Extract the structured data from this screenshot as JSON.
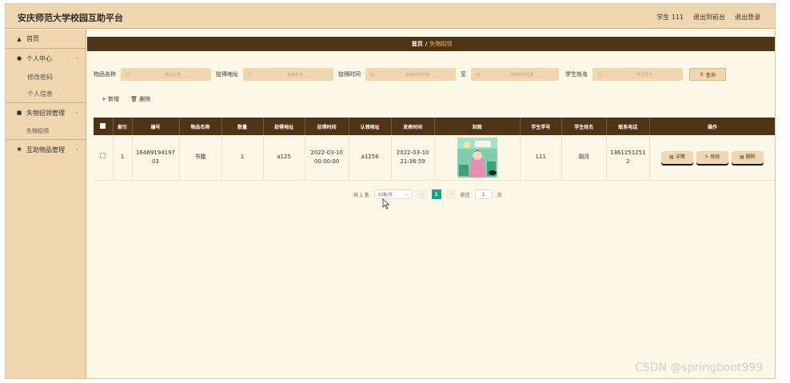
{
  "app": {
    "title": "安庆师范大学校园互助平台",
    "top_links": [
      "学生 111",
      "退出到前台",
      "退出登录"
    ]
  },
  "sidebar": {
    "items": [
      {
        "label": "首页",
        "icon": "home-icon"
      },
      {
        "label": "个人中心",
        "icon": "user-icon"
      },
      {
        "label": "修改密码"
      },
      {
        "label": "个人信息"
      },
      {
        "label": "失物招领管理",
        "icon": "folder-icon"
      },
      {
        "label": "失物招领"
      },
      {
        "label": "互助物品管理",
        "icon": "gear-icon"
      }
    ]
  },
  "breadcrumb": {
    "home": "首页",
    "sep": "/",
    "current": "失物招领"
  },
  "search": {
    "fields": [
      {
        "label": "物品名称",
        "placeholder": "物品名称"
      },
      {
        "label": "拾得地址",
        "placeholder": "拾得地址"
      },
      {
        "label": "拾得时间",
        "placeholder": "拾得时间开始"
      },
      {
        "label": "至",
        "placeholder": "拾得时间结束"
      },
      {
        "label": "学生姓名",
        "placeholder": "学生姓名"
      }
    ],
    "query_label": "查询"
  },
  "toolbar": {
    "add_label": "新增",
    "delete_label": "删除"
  },
  "table": {
    "headers": [
      "索引",
      "编号",
      "物品名称",
      "数量",
      "拾得地址",
      "拾得时间",
      "认领地址",
      "发表时间",
      "封面",
      "学生学号",
      "学生姓名",
      "联系电话",
      "操作"
    ],
    "rows": [
      {
        "index": "1",
        "code_l1": "16469194197",
        "code_l2": "03",
        "name": "书籍",
        "qty": "1",
        "pickup_addr": "a125",
        "pickup_date": "2022-03-10",
        "pickup_time": "00:00:00",
        "claim_addr": "a1256",
        "pub_date": "2022-03-10",
        "pub_time": "21:36:59",
        "student_no": "111",
        "student_name": "胡月",
        "phone_l1": "1361251251",
        "phone_l2": "2",
        "actions": [
          "详情",
          "修改",
          "删除"
        ]
      }
    ]
  },
  "pager": {
    "total": "共 1 条",
    "page_size": "10条/页",
    "current": "1",
    "goto_label": "前往",
    "goto_value": "1",
    "page_unit": "页"
  },
  "watermark": "CSDN @springboot999"
}
